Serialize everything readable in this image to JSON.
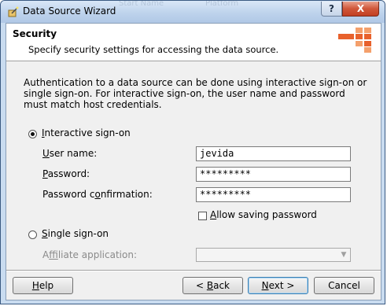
{
  "window": {
    "title": "Data Source Wizard",
    "ghost_text_1": "Start Name",
    "ghost_text_2": "Platform",
    "help_btn": "?",
    "close_btn": "X"
  },
  "header": {
    "title": "Security",
    "subtitle": "Specify security settings for accessing the data source."
  },
  "description": "Authentication to a data source can be done using interactive sign-on or single sign-on. For interactive sign-on, the user name and password must match host credentials.",
  "interactive": {
    "selected": true,
    "label_pre": "",
    "label_mn": "I",
    "label_post": "nteractive sign-on"
  },
  "fields": {
    "username": {
      "mn": "U",
      "rest": "ser name:",
      "value": "jevida"
    },
    "password": {
      "mn": "P",
      "rest": "assword:",
      "value": "*********"
    },
    "password_confirm": {
      "pre": "Password c",
      "mn": "o",
      "rest": "nfirmation:",
      "value": "*********"
    }
  },
  "allow_saving": {
    "checked": false,
    "mn": "A",
    "rest": "llow saving password"
  },
  "single": {
    "selected": false,
    "mn": "S",
    "rest": "ingle sign-on"
  },
  "affiliate": {
    "pre": "A",
    "mn": "f",
    "rest": "filiate application:",
    "value": ""
  },
  "buttons": {
    "help": {
      "mn": "H",
      "rest": "elp"
    },
    "back": {
      "pre": "< ",
      "mn": "B",
      "rest": "ack"
    },
    "next": {
      "mn": "N",
      "rest": "ext >"
    },
    "cancel": "Cancel"
  },
  "colors": {
    "logo_orange": "#e8612c",
    "logo_light": "#f4a06c"
  }
}
